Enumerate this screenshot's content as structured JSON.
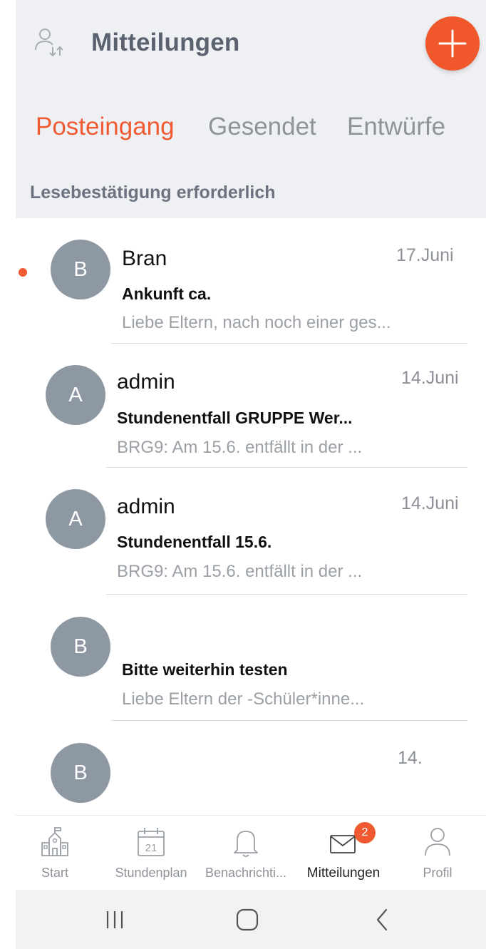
{
  "header": {
    "title": "Mitteilungen",
    "tabs": [
      {
        "label": "Posteingang",
        "active": true
      },
      {
        "label": "Gesendet",
        "active": false
      },
      {
        "label": "Entwürfe",
        "active": false
      }
    ],
    "section_label": "Lesebestätigung erforderlich"
  },
  "messages": [
    {
      "avatar": "B",
      "sender": "Bran",
      "date": "17.Juni",
      "subject": "Ankunft ca.",
      "preview": "Liebe Eltern, nach noch einer ges...",
      "unread": true
    },
    {
      "avatar": "A",
      "sender": "admin",
      "date": "14.Juni",
      "subject": "Stundenentfall      GRUPPE Wer...",
      "preview": "BRG9: Am 15.6. entfällt in der        ...",
      "unread": false
    },
    {
      "avatar": "A",
      "sender": "admin",
      "date": "14.Juni",
      "subject": "Stundenentfall 15.6.",
      "preview": "BRG9: Am 15.6. entfällt in der        ...",
      "unread": false
    },
    {
      "avatar": "B",
      "sender": "",
      "date": "",
      "subject": "Bitte weiterhin testen",
      "preview": "Liebe Eltern der      -Schüler*inne...",
      "unread": false
    },
    {
      "avatar": "B",
      "sender": "",
      "date": "14.",
      "subject": "",
      "preview": "",
      "unread": false
    }
  ],
  "bottom_nav": {
    "items": [
      {
        "label": "Start",
        "icon": "school-icon"
      },
      {
        "label": "Stundenplan",
        "icon": "calendar-icon",
        "icon_text": "21"
      },
      {
        "label": "Benachrichti...",
        "icon": "bell-icon"
      },
      {
        "label": "Mitteilungen",
        "icon": "mail-icon",
        "badge": "2",
        "active": true
      },
      {
        "label": "Profil",
        "icon": "person-icon"
      }
    ]
  },
  "colors": {
    "accent": "#ef5a33",
    "avatar": "#8e98a2",
    "header_bg": "#eef0f3"
  }
}
